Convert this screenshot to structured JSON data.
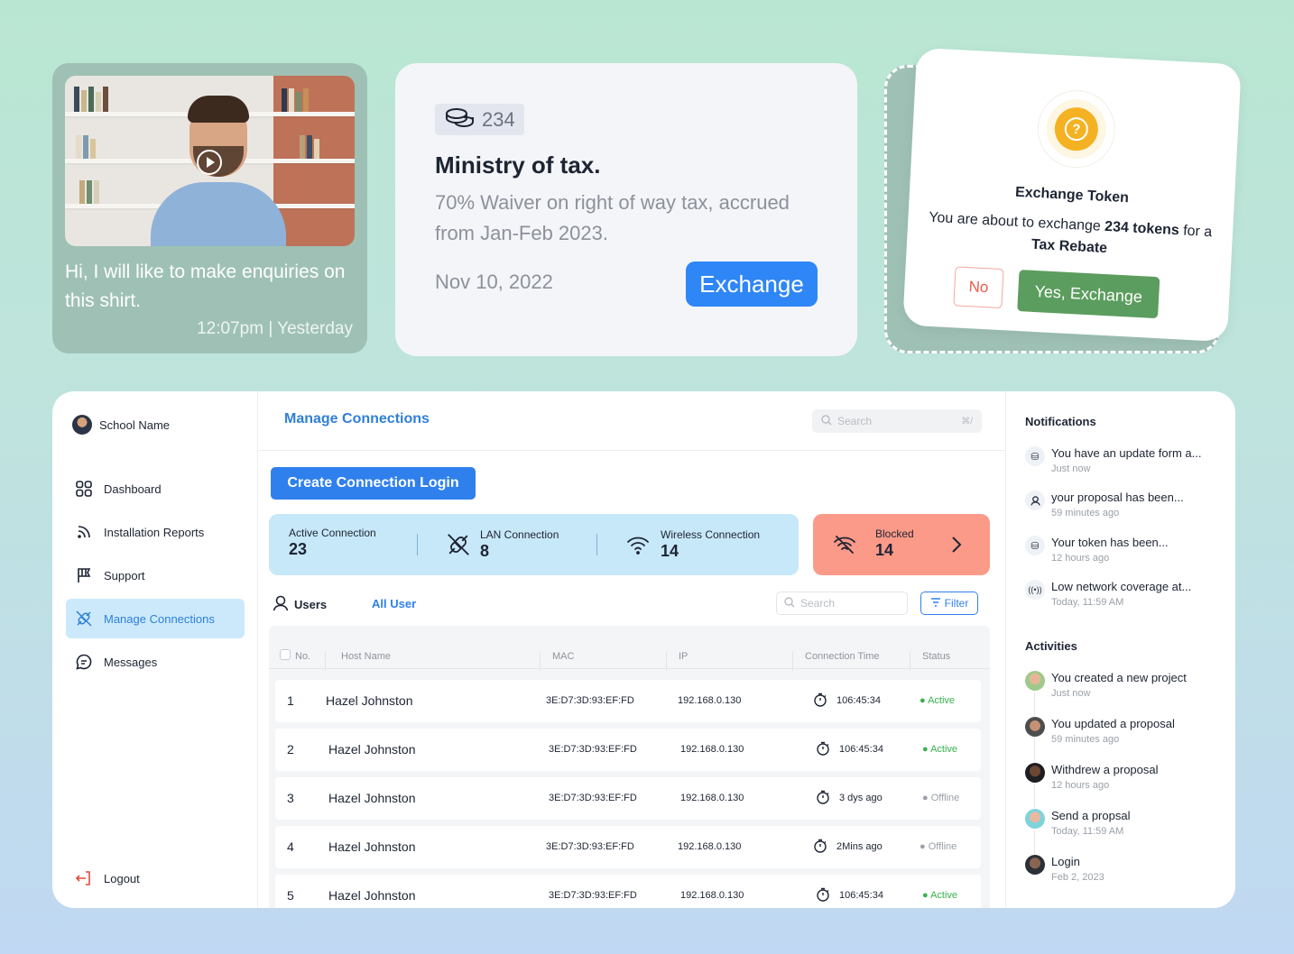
{
  "video_card": {
    "message": "Hi, I will like to make enquiries on this shirt.",
    "time": "12:07pm | Yesterday"
  },
  "tax_card": {
    "token_count": "234",
    "title": "Ministry of tax.",
    "description": "70% Waiver on right of way tax, accrued from Jan-Feb 2023.",
    "date": "Nov 10, 2022",
    "exchange_label": "Exchange"
  },
  "dialog": {
    "title": "Exchange Token",
    "text_before": "You are about to exchange ",
    "tokens": "234 tokens",
    "text_mid": " for a ",
    "target": "Tax Rebate",
    "no_label": "No",
    "yes_label": "Yes, Exchange"
  },
  "sidebar": {
    "school_name": "School Name",
    "items": [
      {
        "label": "Dashboard",
        "icon": "grid-icon"
      },
      {
        "label": "Installation Reports",
        "icon": "rss-icon"
      },
      {
        "label": "Support",
        "icon": "flag-icon"
      },
      {
        "label": "Manage Connections",
        "icon": "plug-icon",
        "active": true
      },
      {
        "label": "Messages",
        "icon": "chat-icon"
      }
    ],
    "logout_label": "Logout"
  },
  "main": {
    "title": "Manage Connections",
    "search_placeholder": "Search",
    "search_shortcut": "⌘/",
    "create_label": "Create Connection Login",
    "stats": {
      "active_label": "Active Connection",
      "active_value": "23",
      "lan_label": "LAN Connection",
      "lan_value": "8",
      "wireless_label": "Wireless Connection",
      "wireless_value": "14",
      "blocked_label": "Blocked",
      "blocked_value": "14"
    },
    "users_label": "Users",
    "all_user_label": "All User",
    "table_search_placeholder": "Search",
    "filter_label": "Filter",
    "columns": [
      "No.",
      "Host Name",
      "MAC",
      "IP",
      "Connection Time",
      "Status"
    ],
    "rows": [
      {
        "no": "1",
        "host": "Hazel Johnston",
        "mac": "3E:D7:3D:93:EF:FD",
        "ip": "192.168.0.130",
        "time": "106:45:34",
        "status": "Active"
      },
      {
        "no": "2",
        "host": "Hazel Johnston",
        "mac": "3E:D7:3D:93:EF:FD",
        "ip": "192.168.0.130",
        "time": "106:45:34",
        "status": "Active"
      },
      {
        "no": "3",
        "host": "Hazel Johnston",
        "mac": "3E:D7:3D:93:EF:FD",
        "ip": "192.168.0.130",
        "time": "3 dys ago",
        "status": "Offline"
      },
      {
        "no": "4",
        "host": "Hazel Johnston",
        "mac": "3E:D7:3D:93:EF:FD",
        "ip": "192.168.0.130",
        "time": "2Mins ago",
        "status": "Offline"
      },
      {
        "no": "5",
        "host": "Hazel Johnston",
        "mac": "3E:D7:3D:93:EF:FD",
        "ip": "192.168.0.130",
        "time": "106:45:34",
        "status": "Active"
      }
    ]
  },
  "notifications": {
    "title": "Notifications",
    "items": [
      {
        "text": "You have an update form a...",
        "time": "Just now",
        "icon": "token-icon"
      },
      {
        "text": "your proposal has been...",
        "time": "59 minutes ago",
        "icon": "user-icon"
      },
      {
        "text": "Your token has been...",
        "time": "12 hours ago",
        "icon": "token-icon"
      },
      {
        "text": "Low network coverage at...",
        "time": "Today, 11:59 AM",
        "icon": "signal-icon"
      }
    ]
  },
  "activities": {
    "title": "Activities",
    "items": [
      {
        "text": "You created a new project",
        "time": "Just now"
      },
      {
        "text": "You updated a proposal",
        "time": "59 minutes ago"
      },
      {
        "text": "Withdrew a proposal",
        "time": "12 hours ago"
      },
      {
        "text": "Send a propsal",
        "time": "Today, 11:59 AM"
      },
      {
        "text": "Login",
        "time": "Feb 2, 2023"
      }
    ]
  },
  "colors": {
    "accent": "#2f80ed",
    "active_status": "#37b24d",
    "blocked": "#fb9a88",
    "yes_button": "#5b9d5e",
    "token_gold": "#f4b223"
  }
}
